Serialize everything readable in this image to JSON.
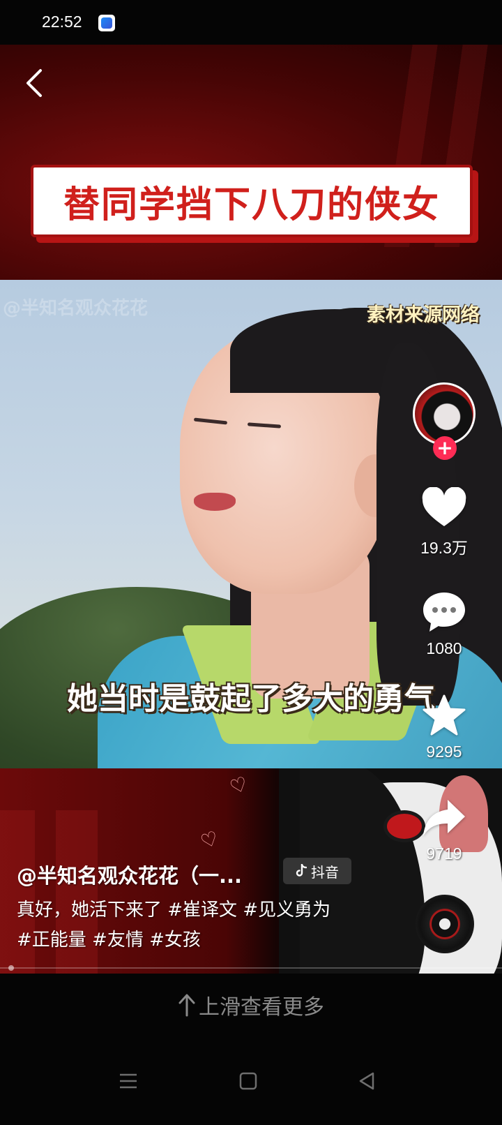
{
  "status_bar": {
    "time": "22:52"
  },
  "video": {
    "title_card": "替同学挡下八刀的侠女",
    "watermark": "@半知名观众花花",
    "source_label": "素材来源网络",
    "subtitle": "她当时是鼓起了多大的勇气"
  },
  "post": {
    "author": "@半知名观众花花（一...",
    "platform_badge": "抖音",
    "caption": "真好，她活下来了 #崔译文 #见义勇为 #正能量 #友情 #女孩"
  },
  "actions": {
    "likes": "19.3万",
    "comments": "1080",
    "favorites": "9295",
    "shares": "9719"
  },
  "footer": {
    "swipe_hint": "上滑查看更多"
  },
  "icons": [
    "back-icon",
    "heart-icon",
    "comment-icon",
    "star-icon",
    "share-icon",
    "menu-icon",
    "home-icon",
    "back-triangle-icon"
  ],
  "colors": {
    "accent": "#fe2c55",
    "title_red": "#d0201c",
    "banner_red": "#7a0d0d"
  }
}
